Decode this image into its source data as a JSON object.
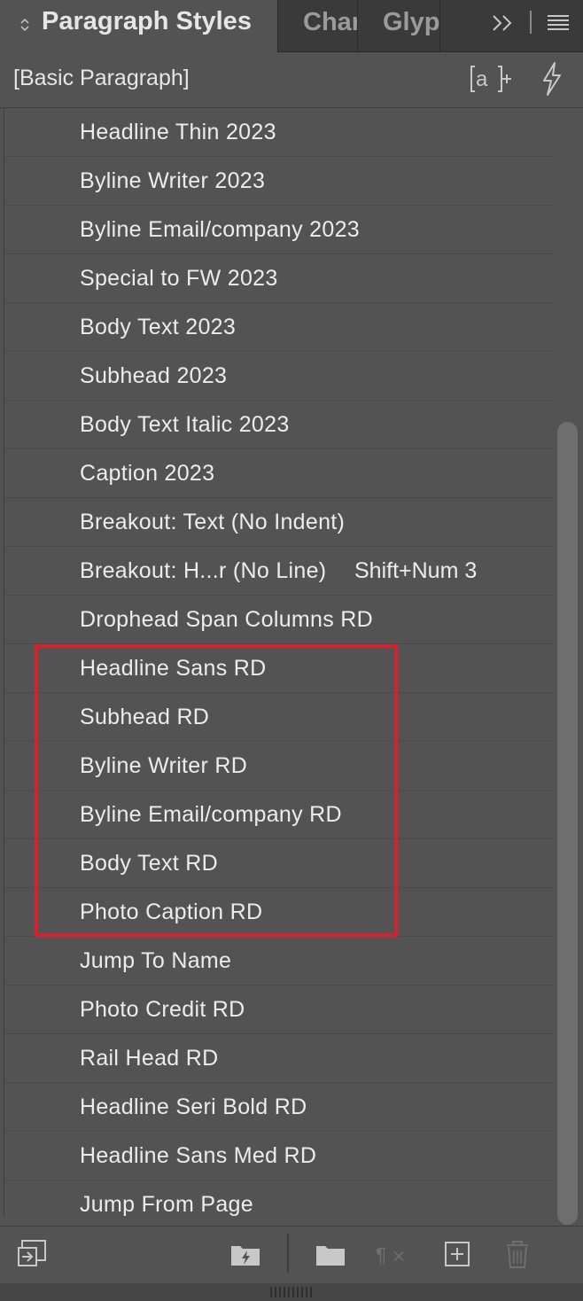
{
  "tabs": {
    "active": "Paragraph Styles",
    "others": [
      "Character Styles",
      "Glyphs"
    ],
    "others_visible": [
      "Char",
      "Glyp"
    ]
  },
  "header": {
    "current_style": "[Basic Paragraph]"
  },
  "styles": [
    {
      "label": "Headline Thin 2023",
      "shortcut": ""
    },
    {
      "label": "Byline Writer 2023",
      "shortcut": ""
    },
    {
      "label": "Byline Email/company 2023",
      "shortcut": ""
    },
    {
      "label": "Special to FW 2023",
      "shortcut": ""
    },
    {
      "label": "Body Text 2023",
      "shortcut": ""
    },
    {
      "label": "Subhead 2023",
      "shortcut": ""
    },
    {
      "label": "Body Text Italic 2023",
      "shortcut": ""
    },
    {
      "label": "Caption 2023",
      "shortcut": ""
    },
    {
      "label": "Breakout: Text (No Indent)",
      "shortcut": ""
    },
    {
      "label": "Breakout: H...r (No Line)",
      "shortcut": "Shift+Num 3"
    },
    {
      "label": "Drophead Span Columns RD",
      "shortcut": ""
    },
    {
      "label": "Headline Sans RD",
      "shortcut": ""
    },
    {
      "label": "Subhead RD",
      "shortcut": ""
    },
    {
      "label": "Byline Writer RD",
      "shortcut": ""
    },
    {
      "label": "Byline Email/company RD",
      "shortcut": ""
    },
    {
      "label": "Body Text RD",
      "shortcut": ""
    },
    {
      "label": "Photo Caption RD",
      "shortcut": ""
    },
    {
      "label": "Jump To Name",
      "shortcut": ""
    },
    {
      "label": "Photo Credit RD",
      "shortcut": ""
    },
    {
      "label": "Rail Head RD",
      "shortcut": ""
    },
    {
      "label": "Headline Seri Bold RD",
      "shortcut": ""
    },
    {
      "label": "Headline Sans Med RD",
      "shortcut": ""
    },
    {
      "label": "Jump From Page",
      "shortcut": ""
    }
  ],
  "highlight": {
    "color": "#d9202e",
    "items": [
      "Headline Sans RD",
      "Subhead RD",
      "Byline Writer RD",
      "Byline Email/company RD",
      "Body Text RD",
      "Photo Caption RD"
    ]
  },
  "icons": {
    "tab_collapse": "collapse-arrows-icon",
    "more_tabs": "double-chevron-right-icon",
    "panel_menu": "hamburger-menu-icon",
    "quick_apply": "quick-apply-icon",
    "lightning": "lightning-icon",
    "footer": [
      "load-styles-icon",
      "folder-lightning-icon",
      "new-group-icon",
      "clear-overrides-icon",
      "new-style-icon",
      "delete-icon"
    ]
  },
  "scroll": {
    "position_fraction": 0.27,
    "visible_fraction": 0.72
  }
}
